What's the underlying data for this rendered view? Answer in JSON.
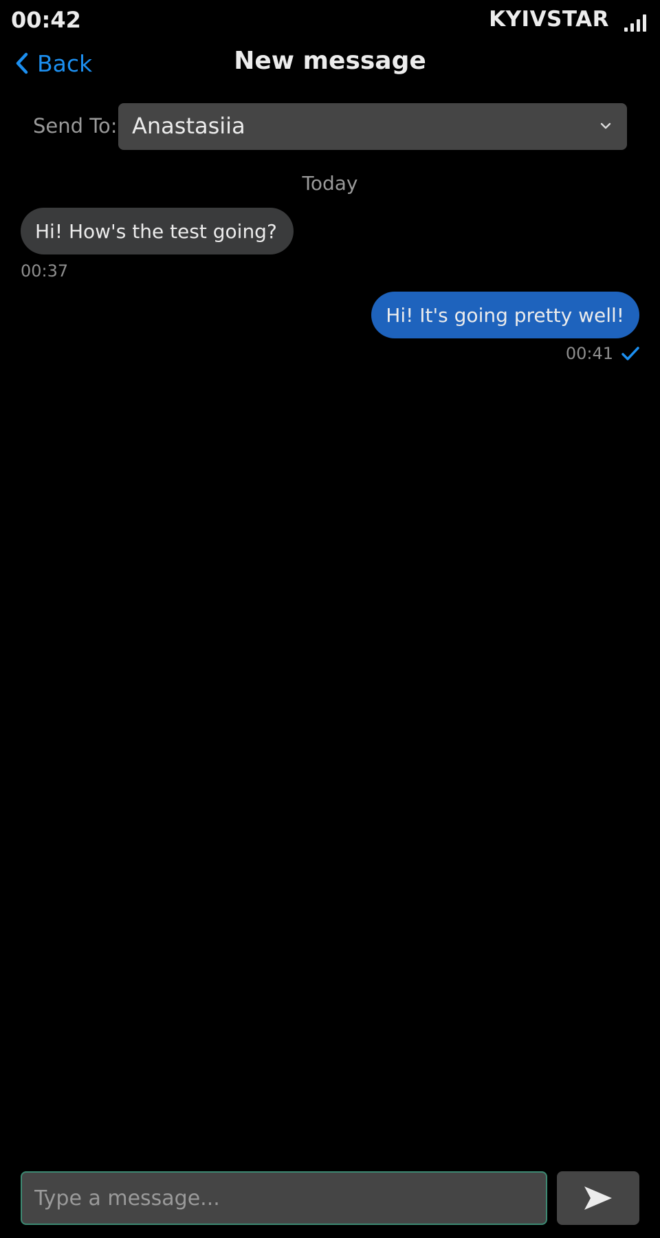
{
  "status_bar": {
    "time": "00:42",
    "carrier": "KYIVSTAR",
    "signal_icon": "signal-bars-icon"
  },
  "nav": {
    "back_icon": "chevron-left-icon",
    "back_label": "Back",
    "title": "New message"
  },
  "recipient": {
    "label": "Send To:",
    "selected": "Anastasiia",
    "dropdown_icon": "chevron-down-icon"
  },
  "conversation": {
    "date_label": "Today",
    "messages": [
      {
        "direction": "incoming",
        "text": "Hi! How's the test going?",
        "time": "00:37"
      },
      {
        "direction": "outgoing",
        "text": "Hi! It's going pretty well!",
        "time": "00:41",
        "status_icon": "check-icon"
      }
    ]
  },
  "composer": {
    "placeholder": "Type a message...",
    "value": "",
    "send_icon": "send-icon"
  },
  "colors": {
    "background": "#000000",
    "accent": "#1c8ff0",
    "outgoing_bubble": "#1e63bd",
    "incoming_bubble": "#3a3b3c",
    "field": "#454545",
    "input_focus_border": "#3d8a73",
    "secondary_text": "#9a9a9a"
  }
}
